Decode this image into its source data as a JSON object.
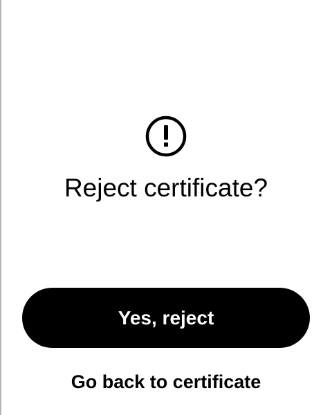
{
  "dialog": {
    "icon": "exclamation-circle-icon",
    "title": "Reject certificate?",
    "primary_button_label": "Yes, reject",
    "secondary_button_label": "Go back to certificate"
  },
  "colors": {
    "background": "#ffffff",
    "primary_button_bg": "#000000",
    "primary_button_text": "#ffffff",
    "text": "#000000"
  }
}
